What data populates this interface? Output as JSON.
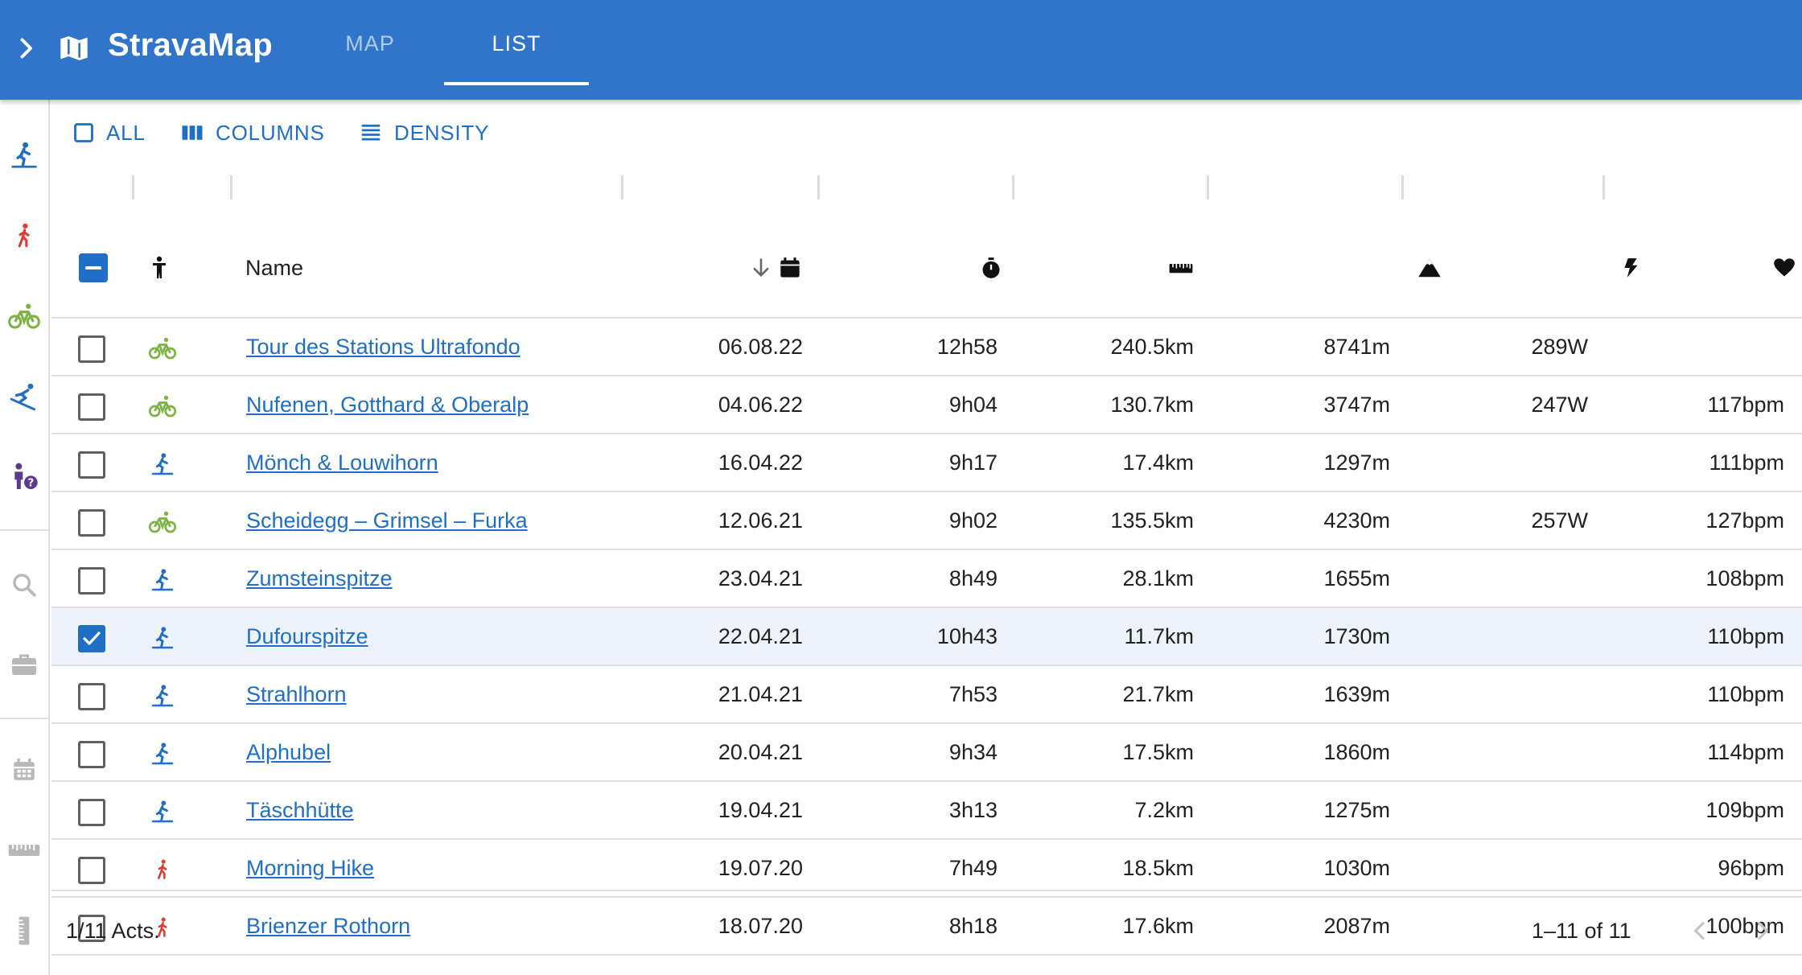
{
  "app": {
    "title": "StravaMap"
  },
  "tabs": [
    {
      "label": "MAP",
      "active": false
    },
    {
      "label": "LIST",
      "active": true
    }
  ],
  "theme": {
    "primary": "#3175cb",
    "link": "#1e6fc5",
    "ride": "#7cb342",
    "hike": "#e53935",
    "ski_tour": "#1e6fc5",
    "other": "#5e3a8c"
  },
  "sidebar": {
    "filters": [
      {
        "icon": "ski-touring-icon"
      },
      {
        "icon": "hiking-icon"
      },
      {
        "icon": "bike-icon"
      },
      {
        "icon": "alpine-ski-icon"
      },
      {
        "icon": "other-activity-icon"
      }
    ],
    "tools": [
      {
        "icon": "search-icon"
      },
      {
        "icon": "briefcase-icon"
      },
      {
        "icon": "calendar-icon"
      },
      {
        "icon": "ruler-icon"
      },
      {
        "icon": "vertical-ruler-icon"
      }
    ]
  },
  "toolbar": {
    "all_label": "ALL",
    "columns_label": "COLUMNS",
    "density_label": "DENSITY"
  },
  "columns": {
    "type_icon": "person-icon",
    "name": "Name",
    "date_icon": "calendar-icon",
    "date_sort": "descending",
    "time_icon": "stopwatch-icon",
    "distance_icon": "ruler-icon",
    "elevation_icon": "mountain-icon",
    "power_icon": "lightning-icon",
    "heartrate_icon": "heart-icon"
  },
  "activities": [
    {
      "type": "ride",
      "name": "Tour des Stations Ultrafondo",
      "date": "06.08.22",
      "time": "12h58",
      "distance": "240.5km",
      "elevation": "8741m",
      "power": "289W",
      "hr": "",
      "selected": false
    },
    {
      "type": "ride",
      "name": "Nufenen, Gotthard & Oberalp",
      "date": "04.06.22",
      "time": "9h04",
      "distance": "130.7km",
      "elevation": "3747m",
      "power": "247W",
      "hr": "117bpm",
      "selected": false
    },
    {
      "type": "ski_tour",
      "name": "Mönch & Louwihorn",
      "date": "16.04.22",
      "time": "9h17",
      "distance": "17.4km",
      "elevation": "1297m",
      "power": "",
      "hr": "111bpm",
      "selected": false
    },
    {
      "type": "ride",
      "name": "Scheidegg – Grimsel – Furka",
      "date": "12.06.21",
      "time": "9h02",
      "distance": "135.5km",
      "elevation": "4230m",
      "power": "257W",
      "hr": "127bpm",
      "selected": false
    },
    {
      "type": "ski_tour",
      "name": "Zumsteinspitze",
      "date": "23.04.21",
      "time": "8h49",
      "distance": "28.1km",
      "elevation": "1655m",
      "power": "",
      "hr": "108bpm",
      "selected": false
    },
    {
      "type": "ski_tour",
      "name": "Dufourspitze",
      "date": "22.04.21",
      "time": "10h43",
      "distance": "11.7km",
      "elevation": "1730m",
      "power": "",
      "hr": "110bpm",
      "selected": true
    },
    {
      "type": "ski_tour",
      "name": "Strahlhorn",
      "date": "21.04.21",
      "time": "7h53",
      "distance": "21.7km",
      "elevation": "1639m",
      "power": "",
      "hr": "110bpm",
      "selected": false
    },
    {
      "type": "ski_tour",
      "name": "Alphubel",
      "date": "20.04.21",
      "time": "9h34",
      "distance": "17.5km",
      "elevation": "1860m",
      "power": "",
      "hr": "114bpm",
      "selected": false
    },
    {
      "type": "ski_tour",
      "name": "Täschhütte",
      "date": "19.04.21",
      "time": "3h13",
      "distance": "7.2km",
      "elevation": "1275m",
      "power": "",
      "hr": "109bpm",
      "selected": false
    },
    {
      "type": "hike",
      "name": "Morning Hike",
      "date": "19.07.20",
      "time": "7h49",
      "distance": "18.5km",
      "elevation": "1030m",
      "power": "",
      "hr": "96bpm",
      "selected": false
    },
    {
      "type": "hike",
      "name": "Brienzer Rothorn",
      "date": "18.07.20",
      "time": "8h18",
      "distance": "17.6km",
      "elevation": "2087m",
      "power": "",
      "hr": "100bpm",
      "selected": false
    }
  ],
  "footer": {
    "selection": "1/11 Acts.",
    "pagination": "1–11 of 11"
  }
}
